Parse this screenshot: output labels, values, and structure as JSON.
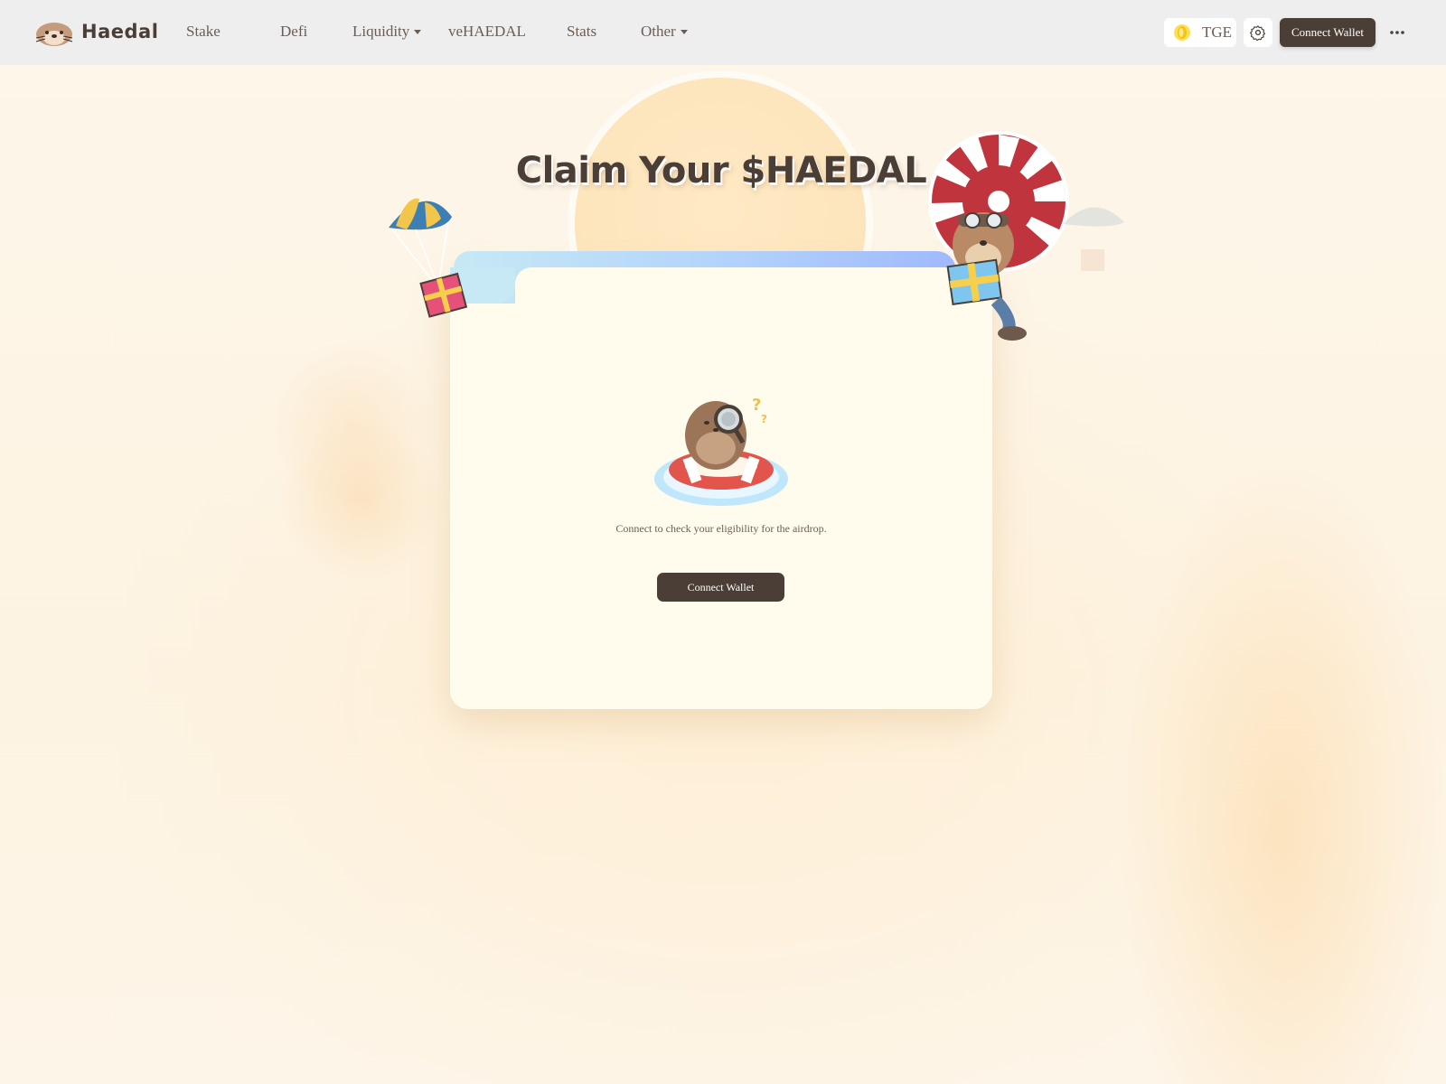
{
  "header": {
    "brand": "Haedal",
    "nav": [
      {
        "label": "Stake",
        "has_dropdown": false
      },
      {
        "label": "Defi",
        "has_dropdown": false
      },
      {
        "label": "Liquidity",
        "has_dropdown": true
      },
      {
        "label": "veHAEDAL",
        "has_dropdown": false
      },
      {
        "label": "Stats",
        "has_dropdown": false
      },
      {
        "label": "Other",
        "has_dropdown": true
      }
    ],
    "tge_label": "TGE",
    "connect_label": "Connect Wallet",
    "icons": {
      "settings": "gear-icon",
      "more": "more-horizontal-icon",
      "tge": "coin-icon"
    }
  },
  "main": {
    "title": "Claim Your $HAEDAL",
    "message": "Connect to check your eligibility for the airdrop.",
    "connect_label": "Connect Wallet"
  },
  "colors": {
    "accent": "#4a3e36",
    "page_bg": "#fdf5e8",
    "header_bg": "#eeeeee",
    "card_bg": "#fffcee",
    "tab_gradient_start": "#c6e9f5",
    "tab_gradient_end": "#9fb9fd"
  }
}
